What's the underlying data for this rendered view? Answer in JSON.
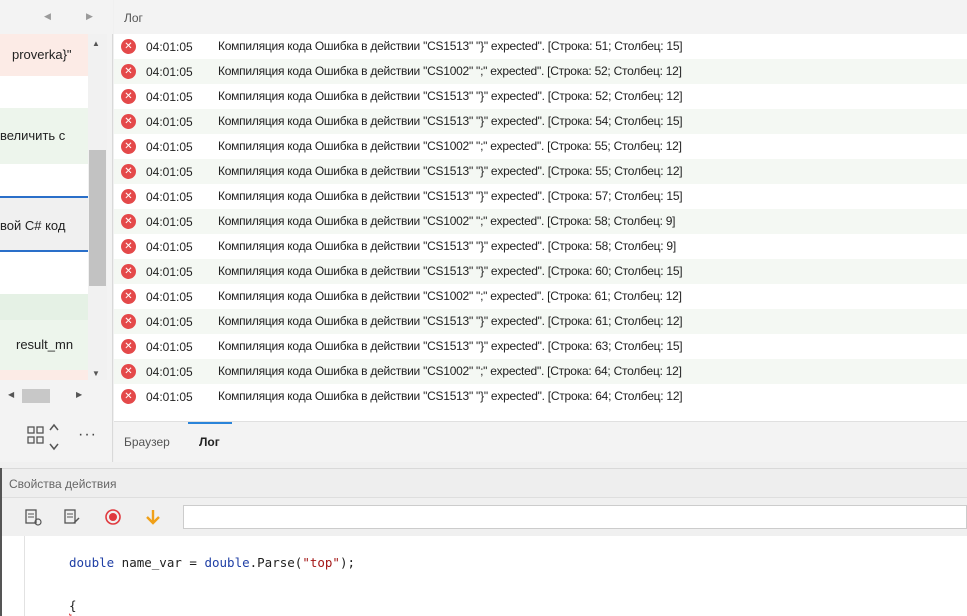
{
  "left": {
    "items": [
      {
        "label": "proverka}\"",
        "bg": "#fcebe6"
      },
      {
        "label": "",
        "bg": "#ffffff"
      },
      {
        "label": "величить с",
        "bg": "#edf5ec"
      },
      {
        "label": "",
        "bg": "#ffffff"
      },
      {
        "label": "вой C# код",
        "bg": "#f0f0f0"
      },
      {
        "label": "",
        "bg": "#ffffff"
      },
      {
        "label": "",
        "bg": "#e5f1e5"
      },
      {
        "label": "result_mn",
        "bg": "#edf5ec"
      },
      {
        "label": "",
        "bg": "#fcebe6"
      }
    ]
  },
  "log": {
    "title": "Лог",
    "rows": [
      {
        "time": "04:01:05",
        "message": "Компиляция кода  Ошибка в действии \"CS1513\" \"}\" expected\". [Строка: 51; Столбец: 15]"
      },
      {
        "time": "04:01:05",
        "message": "Компиляция кода  Ошибка в действии \"CS1002\" \";\" expected\". [Строка: 52; Столбец: 12]"
      },
      {
        "time": "04:01:05",
        "message": "Компиляция кода  Ошибка в действии \"CS1513\" \"}\" expected\". [Строка: 52; Столбец: 12]"
      },
      {
        "time": "04:01:05",
        "message": "Компиляция кода  Ошибка в действии \"CS1513\" \"}\" expected\". [Строка: 54; Столбец: 15]"
      },
      {
        "time": "04:01:05",
        "message": "Компиляция кода  Ошибка в действии \"CS1002\" \";\" expected\". [Строка: 55; Столбец: 12]"
      },
      {
        "time": "04:01:05",
        "message": "Компиляция кода  Ошибка в действии \"CS1513\" \"}\" expected\". [Строка: 55; Столбец: 12]"
      },
      {
        "time": "04:01:05",
        "message": "Компиляция кода  Ошибка в действии \"CS1513\" \"}\" expected\". [Строка: 57; Столбец: 15]"
      },
      {
        "time": "04:01:05",
        "message": "Компиляция кода  Ошибка в действии \"CS1002\" \";\" expected\". [Строка: 58; Столбец: 9]"
      },
      {
        "time": "04:01:05",
        "message": "Компиляция кода  Ошибка в действии \"CS1513\" \"}\" expected\". [Строка: 58; Столбец: 9]"
      },
      {
        "time": "04:01:05",
        "message": "Компиляция кода  Ошибка в действии \"CS1513\" \"}\" expected\". [Строка: 60; Столбец: 15]"
      },
      {
        "time": "04:01:05",
        "message": "Компиляция кода  Ошибка в действии \"CS1002\" \";\" expected\". [Строка: 61; Столбец: 12]"
      },
      {
        "time": "04:01:05",
        "message": "Компиляция кода  Ошибка в действии \"CS1513\" \"}\" expected\". [Строка: 61; Столбец: 12]"
      },
      {
        "time": "04:01:05",
        "message": "Компиляция кода  Ошибка в действии \"CS1513\" \"}\" expected\". [Строка: 63; Столбец: 15]"
      },
      {
        "time": "04:01:05",
        "message": "Компиляция кода  Ошибка в действии \"CS1002\" \";\" expected\". [Строка: 64; Столбец: 12]"
      },
      {
        "time": "04:01:05",
        "message": "Компиляция кода  Ошибка в действии \"CS1513\" \"}\" expected\". [Строка: 64; Столбец: 12]"
      }
    ],
    "tabs": {
      "browser": "Браузер",
      "log": "Лог"
    }
  },
  "props": {
    "title": "Свойства действия"
  },
  "code": {
    "line1": {
      "kw1": "double",
      "t1": " name_var = ",
      "kw2": "double",
      "t2": ".Parse(",
      "str": "\"top\"",
      "t3": ");"
    },
    "line2": "{"
  },
  "colors": {
    "error": "#e4494a",
    "accent_tab": "#2a84d9",
    "record": "#e0393e",
    "arrow": "#f0a018"
  }
}
